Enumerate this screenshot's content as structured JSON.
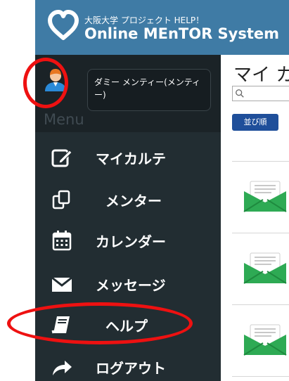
{
  "header": {
    "subtitle": "大阪大学 プロジェクト HELP！",
    "title": "Online MEnTOR System"
  },
  "user": {
    "name": "ダミー メンティー(メンティー)"
  },
  "menu": {
    "header": "Menu",
    "items": [
      {
        "label": "マイカルテ",
        "icon": "edit-icon"
      },
      {
        "label": "メンター",
        "icon": "clone-icon"
      },
      {
        "label": "カレンダー",
        "icon": "calendar-icon"
      },
      {
        "label": "メッセージ",
        "icon": "envelope-icon"
      },
      {
        "label": "ヘルプ",
        "icon": "book-icon"
      },
      {
        "label": "ログアウト",
        "icon": "share-icon"
      }
    ]
  },
  "main": {
    "title": "マイ カ",
    "search_placeholder": "",
    "sort_label": "並び順"
  },
  "colors": {
    "header": "#3f7ba5",
    "sidebar": "#222d32",
    "sort_button": "#1f4f9a",
    "envelope": "#2eaa54",
    "highlight": "#ee1111"
  }
}
